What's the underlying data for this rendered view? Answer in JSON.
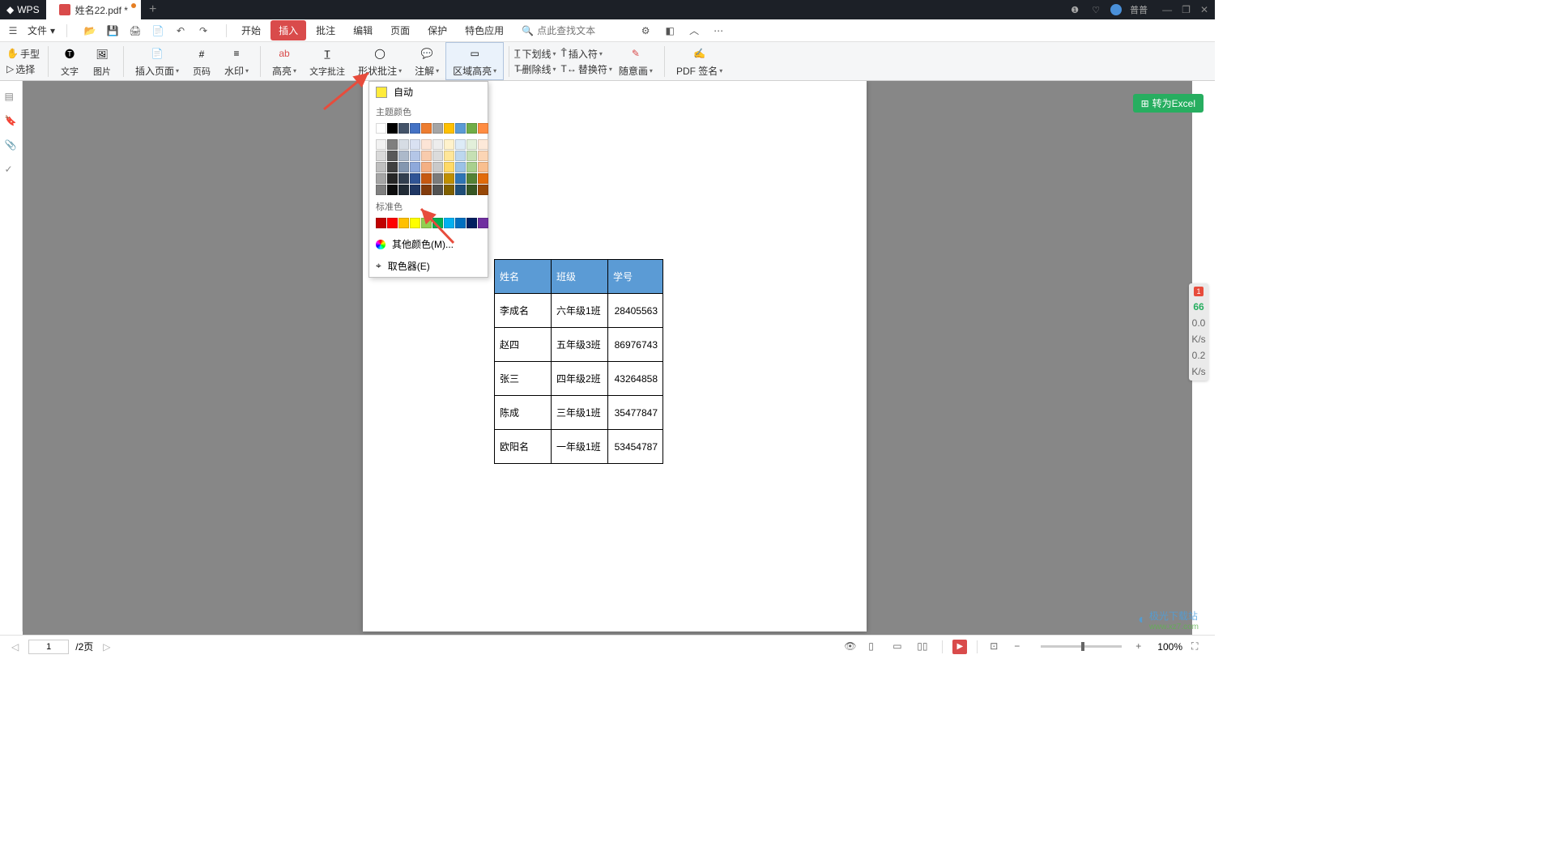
{
  "titlebar": {
    "app_name": "WPS",
    "tab_title": "姓名22.pdf *",
    "user_name": "普普"
  },
  "menubar": {
    "file_label": "文件",
    "tabs": [
      "开始",
      "插入",
      "批注",
      "编辑",
      "页面",
      "保护",
      "特色应用"
    ],
    "active_tab_index": 1,
    "search_placeholder": "点此查找文本"
  },
  "ribbon": {
    "left_tools": {
      "hand": "手型",
      "select": "选择"
    },
    "groups": [
      {
        "label": "文字"
      },
      {
        "label": "图片"
      },
      {
        "label": "插入页面"
      },
      {
        "label": "页码"
      },
      {
        "label": "水印"
      },
      {
        "label": "高亮"
      },
      {
        "label": "文字批注"
      },
      {
        "label": "形状批注"
      },
      {
        "label": "注解"
      },
      {
        "label": "区域高亮"
      },
      {
        "label": "下划线"
      },
      {
        "label": "插入符"
      },
      {
        "label": "删除线"
      },
      {
        "label": "替换符"
      },
      {
        "label": "随意画"
      },
      {
        "label": "PDF 签名"
      }
    ]
  },
  "color_dropdown": {
    "auto": "自动",
    "theme_label": "主题颜色",
    "standard_label": "标准色",
    "more_colors": "其他颜色(M)...",
    "eyedropper": "取色器(E)",
    "theme_row1": [
      "#ffffff",
      "#000000",
      "#44546a",
      "#4472c4",
      "#ed7d31",
      "#a5a5a5",
      "#ffc000",
      "#5b9bd5",
      "#70ad47",
      "#ff8c42"
    ],
    "theme_shades": [
      [
        "#f2f2f2",
        "#7f7f7f",
        "#d6dce4",
        "#d9e1f2",
        "#fce4d6",
        "#ededed",
        "#fff2cc",
        "#ddebf7",
        "#e2efda",
        "#fde9d9"
      ],
      [
        "#d9d9d9",
        "#595959",
        "#acb9ca",
        "#b4c6e7",
        "#f8cbad",
        "#dbdbdb",
        "#ffe699",
        "#bdd7ee",
        "#c6e0b4",
        "#fbd5b5"
      ],
      [
        "#bfbfbf",
        "#404040",
        "#8497b0",
        "#8ea9db",
        "#f4b084",
        "#c9c9c9",
        "#ffd966",
        "#9bc2e6",
        "#a9d08e",
        "#f9bf8f"
      ],
      [
        "#a6a6a6",
        "#262626",
        "#333f4f",
        "#305496",
        "#c65911",
        "#7b7b7b",
        "#bf8f00",
        "#2f75b5",
        "#548235",
        "#e26b0a"
      ],
      [
        "#808080",
        "#0c0c0c",
        "#222b35",
        "#203764",
        "#833c0c",
        "#525252",
        "#806000",
        "#1f4e78",
        "#375623",
        "#974706"
      ]
    ],
    "standard_colors": [
      "#c00000",
      "#ff0000",
      "#ffc000",
      "#ffff00",
      "#92d050",
      "#00b050",
      "#00b0f0",
      "#0070c0",
      "#002060",
      "#7030a0"
    ]
  },
  "convert_button": "转为Excel",
  "chart_data": {
    "type": "table",
    "headers": [
      "姓名",
      "班级",
      "学号"
    ],
    "rows": [
      [
        "李成名",
        "六年级1班",
        "28405563"
      ],
      [
        "赵四",
        "五年级3班",
        "86976743"
      ],
      [
        "张三",
        "四年级2班",
        "43264858"
      ],
      [
        "陈成",
        "三年级1班",
        "35477847"
      ],
      [
        "欧阳名",
        "一年级1班",
        "53454787"
      ]
    ]
  },
  "float_widget": {
    "badge": "1",
    "speed": "66",
    "rate1": "0.0",
    "unit1": "K/s",
    "rate2": "0.2",
    "unit2": "K/s"
  },
  "statusbar": {
    "page_current": "1",
    "page_total": "/2页",
    "zoom": "100%"
  },
  "watermark": {
    "brand": "极光下载站",
    "url": "www.xz7.com"
  }
}
